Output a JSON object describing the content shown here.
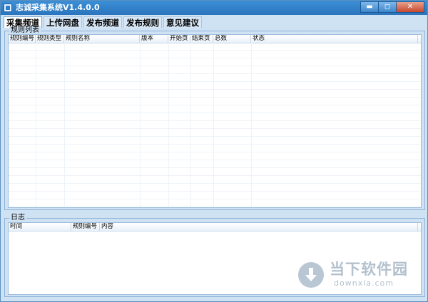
{
  "window": {
    "title": "志诚采集系统V1.4.0.0",
    "buttons": {
      "minimize": "▬",
      "maximize": "◻",
      "close": "✕"
    }
  },
  "tabs": [
    "采集频道",
    "上传网盘",
    "发布频道",
    "发布规则",
    "意见建议"
  ],
  "rule_list": {
    "label": "规则列表",
    "columns": [
      "规则编号",
      "规则类型",
      "规则名称",
      "版本",
      "开始页",
      "结束页",
      "总数",
      "状态"
    ],
    "rows": []
  },
  "log": {
    "label": "日志",
    "columns": [
      "时间",
      "规则编号",
      "内容"
    ],
    "rows": []
  },
  "watermark": {
    "main": "当下软件园",
    "sub": "downxia.com",
    "icon": "download-arrow-icon"
  },
  "colors": {
    "titlebar": "#2a74bd",
    "window_bg": "#cfe2f3",
    "accent": "#3b8fd6"
  }
}
